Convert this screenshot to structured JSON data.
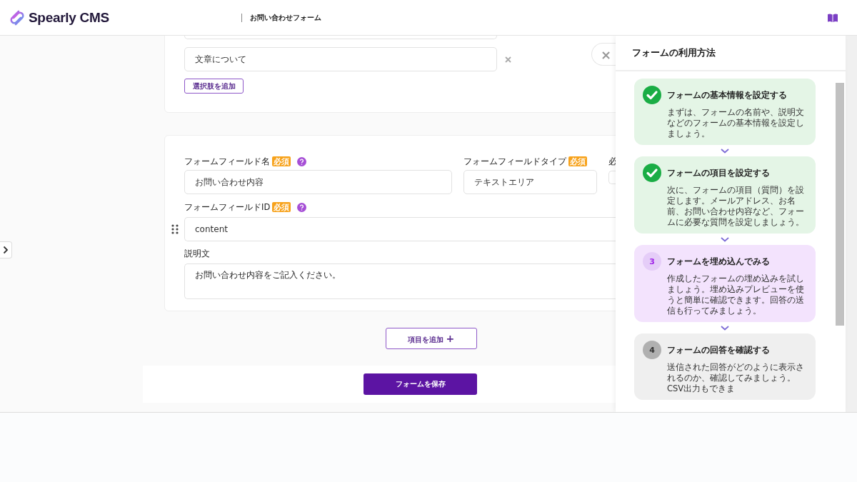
{
  "header": {
    "brand": "Spearly CMS",
    "page_title": "お問い合わせフォーム"
  },
  "choices": {
    "options": [
      {
        "value": "文章について"
      }
    ],
    "add_button": "選択肢を追加"
  },
  "field": {
    "labels": [
      {
        "text": "フォームフィールド名",
        "required": "必須",
        "help": true
      },
      {
        "text": "フォームフィールドタイプ",
        "required": "必須",
        "help": false
      },
      {
        "text": "必"
      }
    ],
    "name_value": "お問い合わせ内容",
    "type_value": "テキストエリア",
    "id_label": {
      "text": "フォームフィールドID",
      "required": "必須",
      "help": true
    },
    "id_value": "content",
    "description_label": "説明文",
    "description_value": "お問い合わせ内容をご記入ください。"
  },
  "add_item_button": "項目を追加",
  "plus": "+",
  "save_button": "フォームを保存",
  "guide": {
    "title": "フォームの利用方法",
    "close": "×",
    "steps": [
      {
        "kind": "done",
        "title": "フォームの基本情報を設定する",
        "text": "まずは、フォームの名前や、説明文などのフォームの基本情報を設定しましょう。"
      },
      {
        "kind": "done",
        "title": "フォームの項目を設定する",
        "text": "次に、フォームの項目（質問）を設定します。メールアドレス、お名前、お問い合わせ内容など、フォームに必要な質問を設定しましょう。"
      },
      {
        "kind": "current",
        "number": "3",
        "title": "フォームを埋め込んでみる",
        "text": "作成したフォームの埋め込みを試しましょう。埋め込みプレビューを使うと簡単に確認できます。回答の送信も行ってみましょう。"
      },
      {
        "kind": "todo",
        "number": "4",
        "title": "フォームの回答を確認する",
        "text": "送信された回答がどのように表示されるのか、確認してみましょう。CSV出力もできま"
      }
    ]
  }
}
